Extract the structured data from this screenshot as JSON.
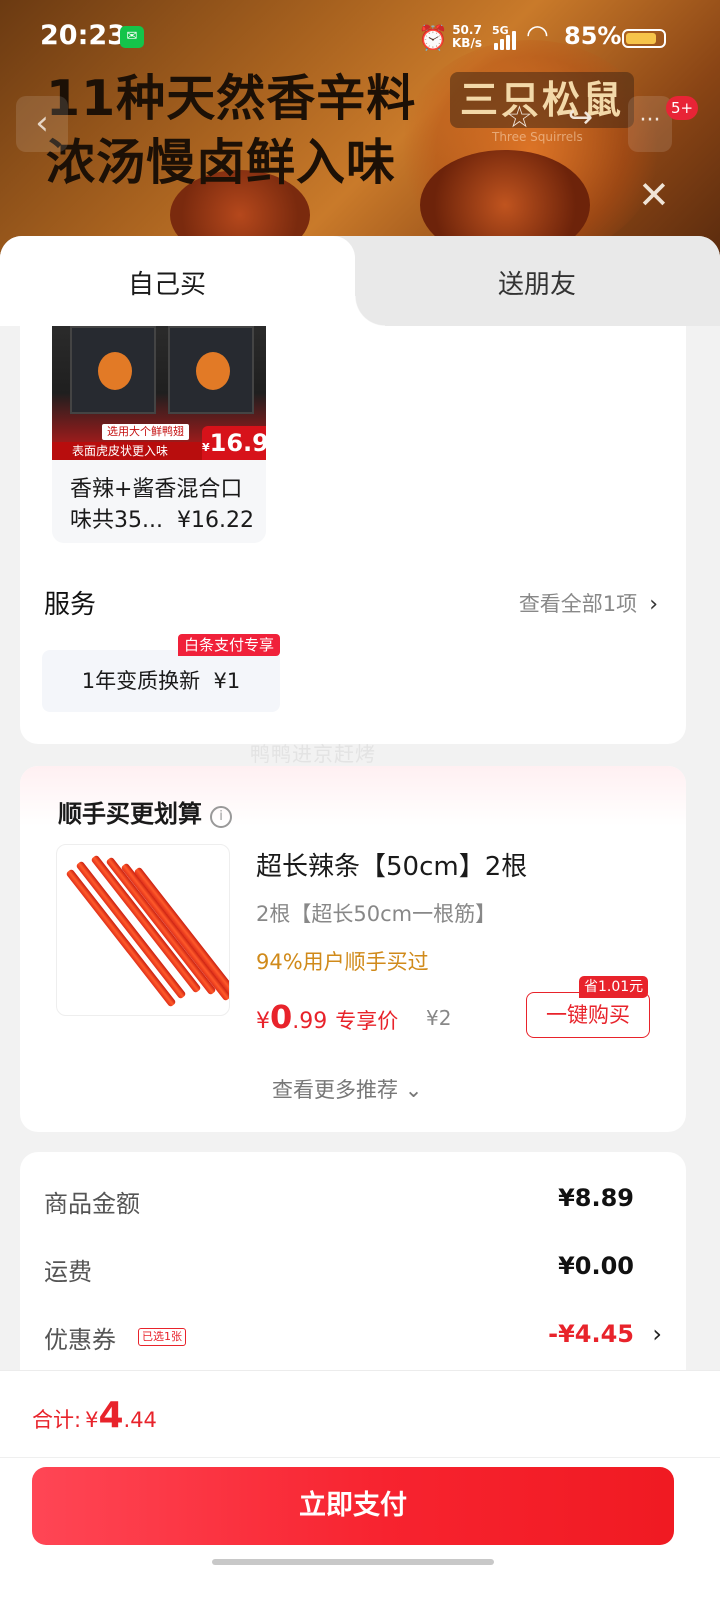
{
  "status_bar": {
    "time": "20:23",
    "net_speed_value": "50.7",
    "net_speed_unit": "KB/s",
    "network": "5G",
    "battery": "85%",
    "icons": [
      "wechat-icon",
      "alarm-icon",
      "signal-icon",
      "wifi-icon",
      "battery-icon"
    ]
  },
  "banner": {
    "headline_line1": "11种天然香辛料",
    "headline_line2": "浓汤慢卤鲜入味",
    "brand": "三只松鼠",
    "brand_sub": "Three Squirrels",
    "notification_badge": "5+"
  },
  "tabs": [
    {
      "label": "自己买",
      "active": true
    },
    {
      "label": "送朋友",
      "active": false
    }
  ],
  "selected_variant": {
    "tag_select": "选用大个鲜鸭翅",
    "tag_surface": "表面虎皮状更入味",
    "tag_price": "16.9",
    "tag_price_currency": "¥",
    "name_line1": "香辣+酱香混合口",
    "name_line2": "味共35...",
    "price": "¥16.22"
  },
  "service": {
    "title": "服务",
    "view_all": "查看全部1项",
    "chip_label": "1年变质换新",
    "chip_price": "¥1",
    "chip_tag": "白条支付专享"
  },
  "watermark": "鸭鸭进京赶烤",
  "addon": {
    "title": "顺手买更划算",
    "product_name": "超长辣条【50cm】2根",
    "spec": "2根【超长50cm一根筋】",
    "social_proof": "94%用户顺手买过",
    "price_currency": "¥",
    "price_int": "0",
    "price_dec": ".99",
    "price_label": "专享价",
    "original_price": "¥2",
    "save_tag": "省1.01元",
    "buy_button": "一键购买",
    "more": "查看更多推荐"
  },
  "summary": {
    "rows": [
      {
        "label": "商品金额",
        "value": "¥8.89"
      },
      {
        "label": "运费",
        "value": "¥0.00"
      },
      {
        "label": "优惠券",
        "tag": "已选1张",
        "value": "-¥4.45"
      }
    ]
  },
  "footer": {
    "total_label": "合计:",
    "total_currency": "¥",
    "total_int": "4",
    "total_dec": ".44",
    "pay_button": "立即支付"
  },
  "colors": {
    "accent_red": "#e8232b",
    "pay_button_start": "#ff4655",
    "pay_button_end": "#f01a22",
    "social_proof_orange": "#d08a1a",
    "banner_brown": "#a8621f"
  }
}
